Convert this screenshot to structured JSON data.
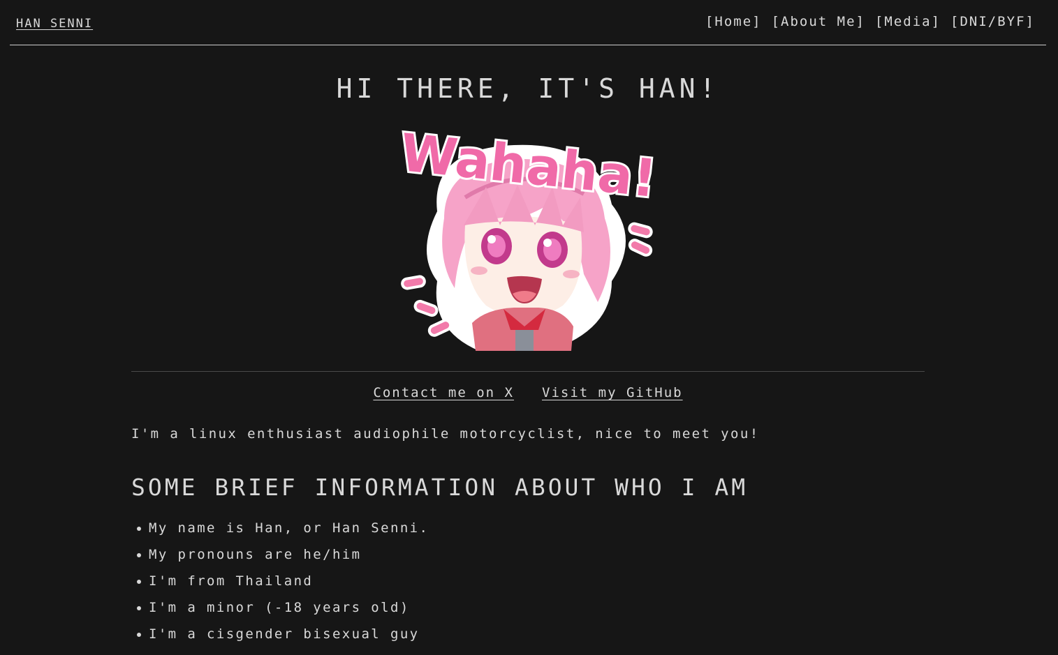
{
  "header": {
    "brand": "HAN SENNI",
    "nav": [
      "[Home]",
      "[About Me]",
      "[Media]",
      "[DNI/BYF]"
    ]
  },
  "main": {
    "title": "HI THERE, IT'S HAN!",
    "sticker_text": "Wahaha!",
    "contacts": [
      "Contact me on X",
      "Visit my GitHub"
    ],
    "intro": "I'm a linux enthusiast audiophile motorcyclist, nice to meet you!",
    "section_title": "SOME BRIEF INFORMATION ABOUT WHO I AM",
    "facts": [
      "My name is Han, or Han Senni.",
      "My pronouns are he/him",
      "I'm from Thailand",
      "I'm a minor (-18 years old)",
      "I'm a cisgender bisexual guy"
    ]
  },
  "colors": {
    "background": "#161616",
    "text": "#d9d9d9",
    "accent_pink": "#f06aa8"
  }
}
